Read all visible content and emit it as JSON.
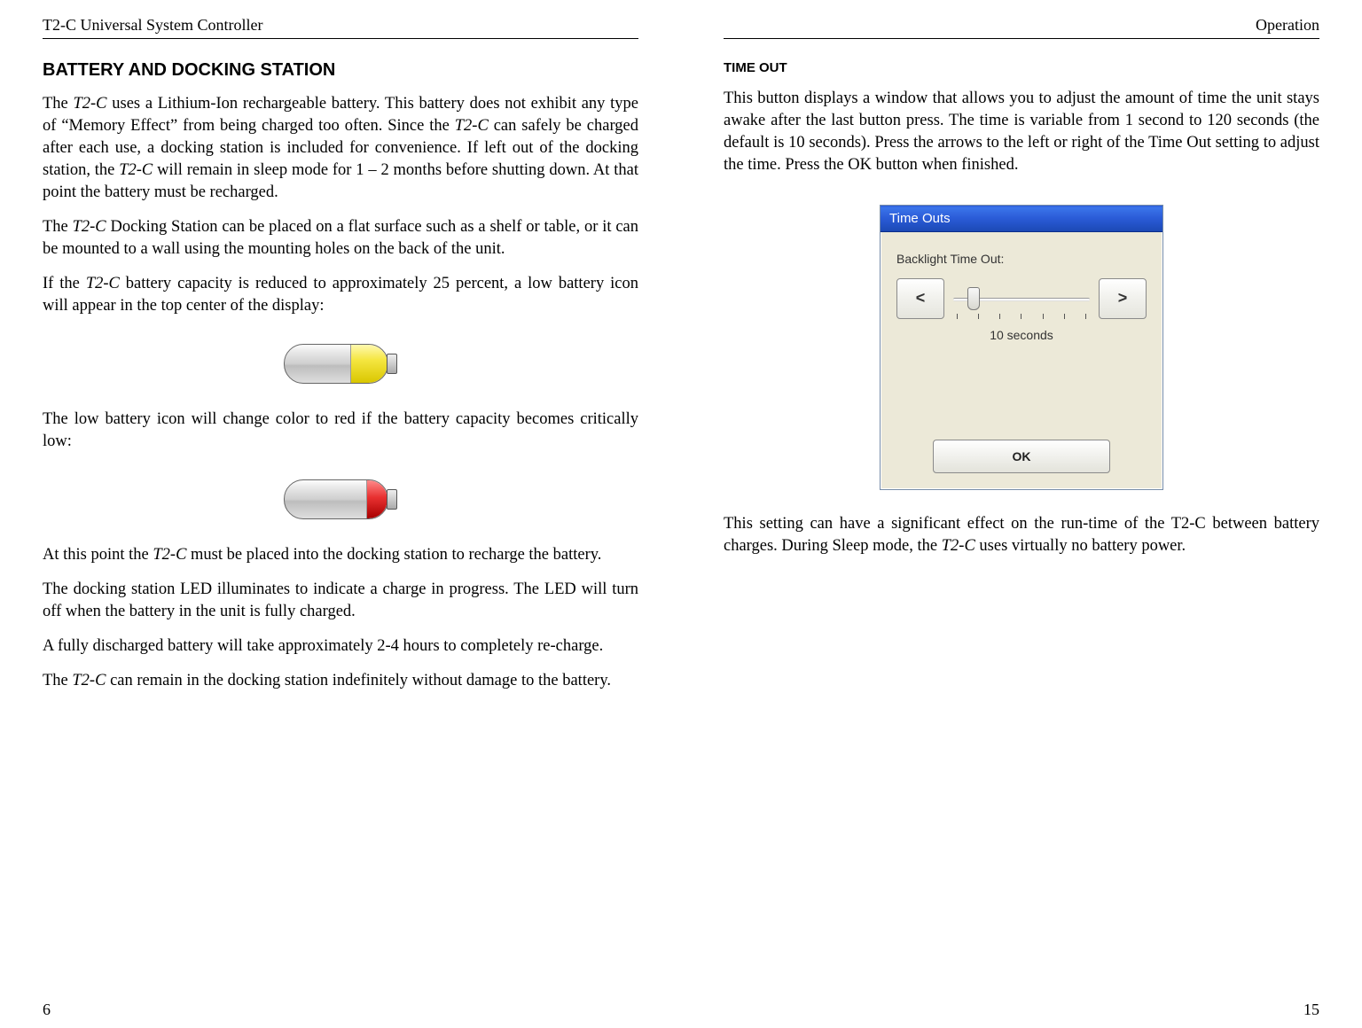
{
  "left": {
    "header_left": "T2-C Universal System Controller",
    "header_right": "",
    "heading": "BATTERY AND DOCKING STATION",
    "p1a": "The ",
    "p1b": "T2-C",
    "p1c": " uses a Lithium-Ion rechargeable battery. This battery does not exhibit any type of “Memory Effect” from being charged too often. Since the ",
    "p1d": "T2-C",
    "p1e": " can safely be charged after each use, a docking station is included for convenience. If left out of the docking station, the ",
    "p1f": "T2-C",
    "p1g": " will remain in sleep mode for 1 – 2 months before shutting down. At that point the battery must be recharged.",
    "p2a": "The ",
    "p2b": "T2-C",
    "p2c": " Docking Station can be placed on a flat surface such as a shelf or table, or it can be mounted to a wall using the mounting holes on the back of the unit.",
    "p3a": "If the ",
    "p3b": "T2-C",
    "p3c": " battery capacity is reduced to approximately 25 percent, a low battery icon will appear in the top center of the display:",
    "p4": "The low battery icon will change color to red if the battery capacity becomes critically low:",
    "p5a": "At this point the ",
    "p5b": "T2-C",
    "p5c": " must be placed into the docking station to recharge the battery.",
    "p6": "The docking station LED illuminates to indicate a charge in progress. The LED will turn off when the battery in the unit is fully charged.",
    "p7": "A fully discharged battery will take approximately 2-4 hours to completely re-charge.",
    "p8a": "The ",
    "p8b": "T2-C",
    "p8c": " can remain in the docking station indefinitely without damage to the battery.",
    "page_num": "6"
  },
  "right": {
    "header_left": "",
    "header_right": "Operation",
    "sub_heading": "TIME OUT",
    "p1a": "This button displays a window that allows you to adjust the amount of time the unit stays awake after the last button press. The time is variable from 1 second to 120 seconds (the default is 10 seconds). Press the arrows to the left or right of the Time Out setting to adjust the time. Press the ",
    "p1_ok": "OK",
    "p1b": " button when finished.",
    "dialog": {
      "title": "Time Outs",
      "label": "Backlight Time Out:",
      "left_arrow": "<",
      "right_arrow": ">",
      "seconds": "10 seconds",
      "ok": "OK"
    },
    "p2a": "This setting can have a significant effect on the run-time of the T2-C between battery charges. During Sleep mode, the ",
    "p2b": "T2-C",
    "p2c": " uses virtually no battery power.",
    "page_num": "15"
  }
}
